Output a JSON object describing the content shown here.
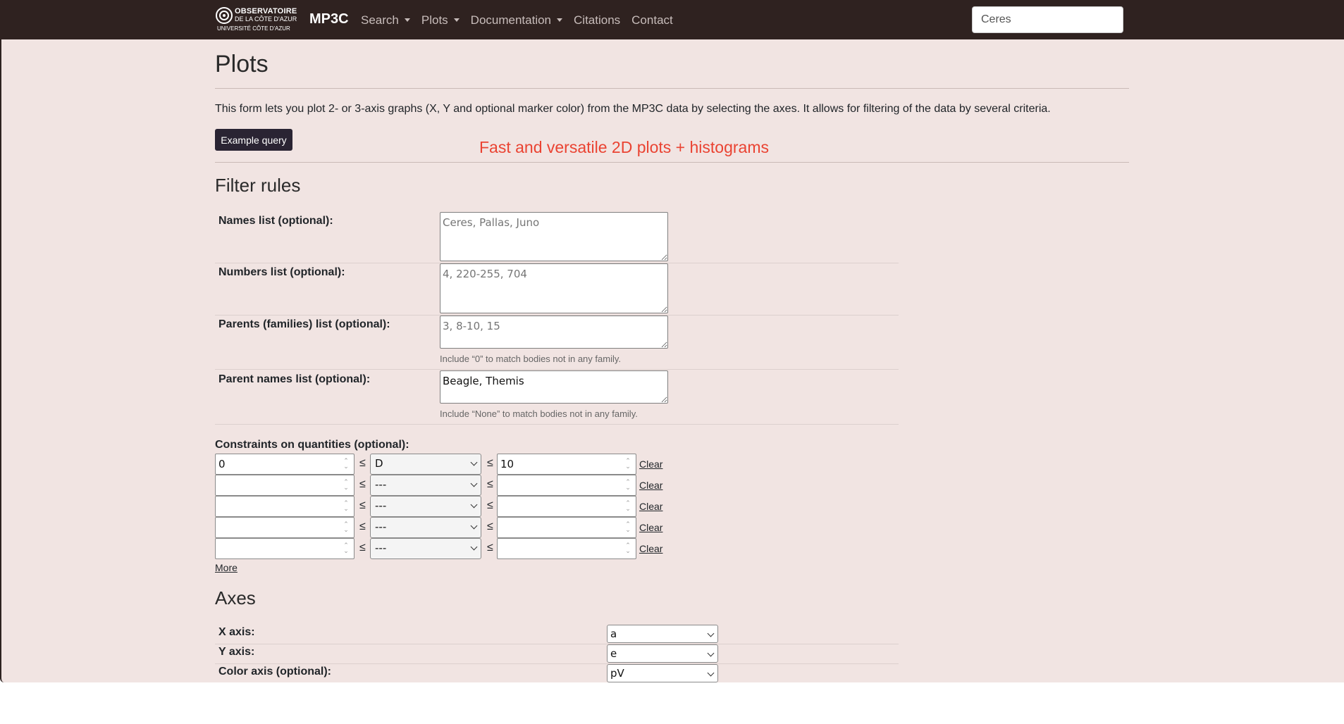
{
  "nav": {
    "logo": {
      "line1": "OBSERVATOIRE",
      "line2": "DE LA CÔTE D'AZUR",
      "line3": "UNIVERSITÉ CÔTE D'AZUR"
    },
    "brand": "MP3C",
    "items": [
      {
        "label": "Search",
        "dropdown": true
      },
      {
        "label": "Plots",
        "dropdown": true
      },
      {
        "label": "Documentation",
        "dropdown": true
      },
      {
        "label": "Citations",
        "dropdown": false
      },
      {
        "label": "Contact",
        "dropdown": false
      }
    ],
    "search_value": "Ceres"
  },
  "page": {
    "title": "Plots",
    "description": "This form lets you plot 2- or 3-axis graphs (X, Y and optional marker color) from the MP3C data by selecting the axes. It allows for filtering of the data by several criteria.",
    "example_button": "Example query",
    "banner": "Fast and versatile 2D plots + histograms"
  },
  "filter": {
    "heading": "Filter rules",
    "names_label": "Names list (optional):",
    "names_placeholder": "Ceres, Pallas, Juno",
    "numbers_label": "Numbers list (optional):",
    "numbers_placeholder": "4, 220-255, 704",
    "parents_label": "Parents (families) list (optional):",
    "parents_placeholder": "3, 8-10, 15",
    "parents_help": "Include “0” to match bodies not in any family.",
    "parent_names_label": "Parent names list (optional):",
    "parent_names_value": "Beagle, Themis",
    "parent_names_help": "Include “None” to match bodies not in any family."
  },
  "constraints": {
    "label": "Constraints on quantities (optional):",
    "le_symbol": "≤",
    "clear_label": "Clear",
    "more_label": "More",
    "rows": [
      {
        "min": "0",
        "quantity": "D",
        "max": "10"
      },
      {
        "min": "",
        "quantity": "---",
        "max": ""
      },
      {
        "min": "",
        "quantity": "---",
        "max": ""
      },
      {
        "min": "",
        "quantity": "---",
        "max": ""
      },
      {
        "min": "",
        "quantity": "---",
        "max": ""
      }
    ]
  },
  "axes": {
    "heading": "Axes",
    "x_label": "X axis:",
    "x_value": "a",
    "y_label": "Y axis:",
    "y_value": "e",
    "color_label": "Color axis (optional):",
    "color_value": "pV"
  },
  "colors": {
    "navbar": "#2f2220",
    "page_background": "#f1e4e2",
    "button": "#2a2433",
    "banner": "#ea4332"
  }
}
